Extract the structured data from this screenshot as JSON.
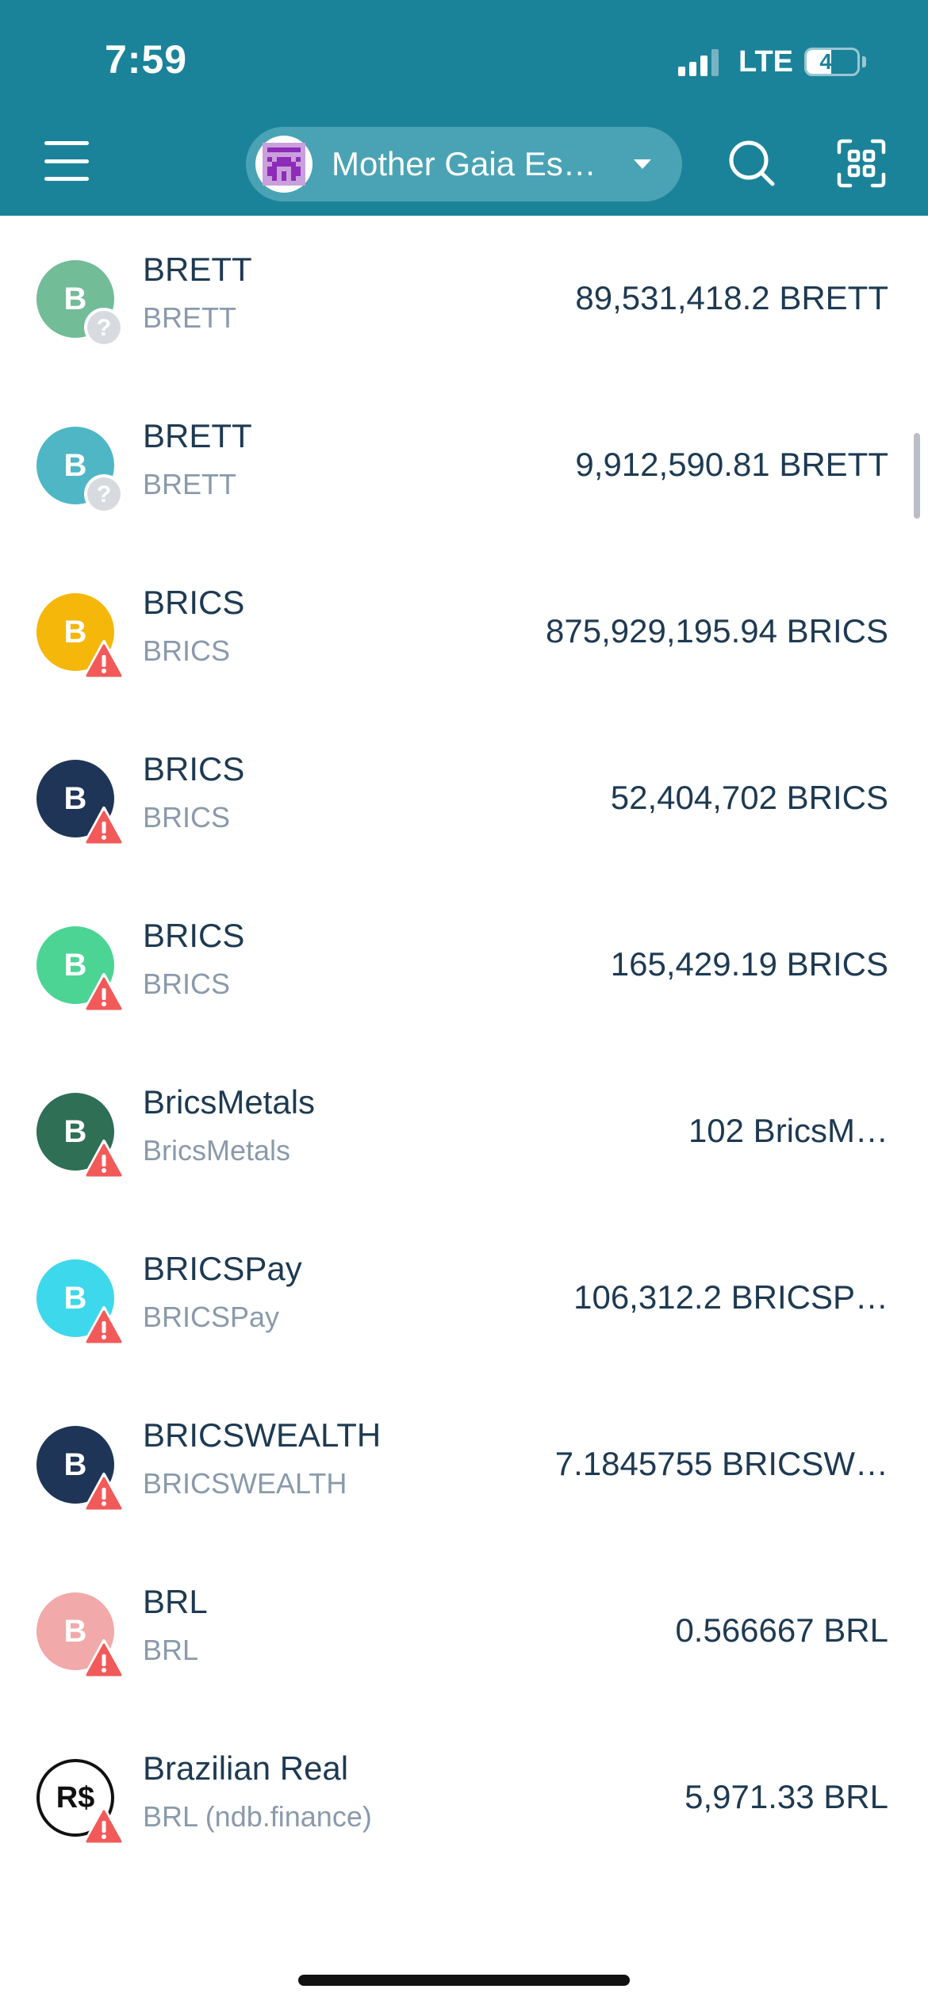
{
  "status_bar": {
    "time": "7:59",
    "network": "LTE",
    "battery": "49",
    "battery_level": 0.49
  },
  "header": {
    "wallet_name": "Mother Gaia Es…",
    "colors": {
      "bar": "#1b8399",
      "pill": "#4aa3b5"
    },
    "icons": {
      "menu": "hamburger-menu-icon",
      "search": "search-icon",
      "scan": "qr-scan-icon",
      "wallet": "wallet-avatar-icon",
      "dropdown": "chevron-down-icon"
    }
  },
  "tokens": [
    {
      "name": "BRETT",
      "symbol": "BRETT",
      "balance": "89,531,418.2 BRETT",
      "letter": "B",
      "color": "#72bc98",
      "badge": "unknown"
    },
    {
      "name": "BRETT",
      "symbol": "BRETT",
      "balance": "9,912,590.81 BRETT",
      "letter": "B",
      "color": "#4fb6c6",
      "badge": "unknown"
    },
    {
      "name": "BRICS",
      "symbol": "BRICS",
      "balance": "875,929,195.94 BRICS",
      "letter": "B",
      "color": "#f5b70a",
      "badge": "warning"
    },
    {
      "name": "BRICS",
      "symbol": "BRICS",
      "balance": "52,404,702 BRICS",
      "letter": "B",
      "color": "#1e3557",
      "badge": "warning"
    },
    {
      "name": "BRICS",
      "symbol": "BRICS",
      "balance": "165,429.19 BRICS",
      "letter": "B",
      "color": "#4cd494",
      "badge": "warning"
    },
    {
      "name": "BricsMetals",
      "symbol": "BricsMetals",
      "balance": "102 BricsM…",
      "letter": "B",
      "color": "#2e6f56",
      "badge": "warning"
    },
    {
      "name": "BRICSPay",
      "symbol": "BRICSPay",
      "balance": "106,312.2 BRICSP…",
      "letter": "B",
      "color": "#3dd8ec",
      "badge": "warning"
    },
    {
      "name": "BRICSWEALTH",
      "symbol": "BRICSWEALTH",
      "balance": "7.1845755 BRICSW…",
      "letter": "B",
      "color": "#1e3557",
      "badge": "warning"
    },
    {
      "name": "BRL",
      "symbol": "BRL",
      "balance": "0.566667 BRL",
      "letter": "B",
      "color": "#f2a9a9",
      "badge": "warning"
    },
    {
      "name": "Brazilian Real",
      "symbol": "BRL (ndb.finance)",
      "balance": "5,971.33 BRL",
      "letter": "R$",
      "color": "#ffffff",
      "badge": "warning",
      "outlined": true
    }
  ]
}
